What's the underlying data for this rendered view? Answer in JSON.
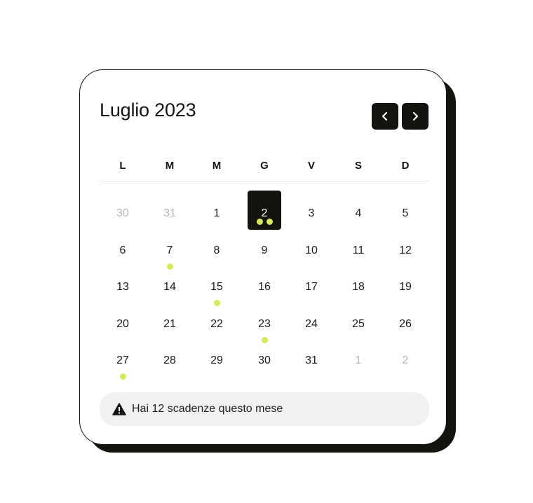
{
  "calendar": {
    "title": "Luglio 2023",
    "nav": {
      "prev_icon": "chevron-left-icon",
      "next_icon": "chevron-right-icon"
    },
    "weekdays": [
      "L",
      "M",
      "M",
      "G",
      "V",
      "S",
      "D"
    ],
    "weeks": [
      [
        {
          "day": "30",
          "muted": true,
          "dots": 0
        },
        {
          "day": "31",
          "muted": true,
          "dots": 0
        },
        {
          "day": "1",
          "muted": false,
          "dots": 0
        },
        {
          "day": "2",
          "muted": false,
          "dots": 2,
          "selected": true
        },
        {
          "day": "3",
          "muted": false,
          "dots": 0
        },
        {
          "day": "4",
          "muted": false,
          "dots": 0
        },
        {
          "day": "5",
          "muted": false,
          "dots": 0
        }
      ],
      [
        {
          "day": "6",
          "muted": false,
          "dots": 0
        },
        {
          "day": "7",
          "muted": false,
          "dots": 1
        },
        {
          "day": "8",
          "muted": false,
          "dots": 0
        },
        {
          "day": "9",
          "muted": false,
          "dots": 0
        },
        {
          "day": "10",
          "muted": false,
          "dots": 0
        },
        {
          "day": "11",
          "muted": false,
          "dots": 0
        },
        {
          "day": "12",
          "muted": false,
          "dots": 0
        }
      ],
      [
        {
          "day": "13",
          "muted": false,
          "dots": 0
        },
        {
          "day": "14",
          "muted": false,
          "dots": 0
        },
        {
          "day": "15",
          "muted": false,
          "dots": 1
        },
        {
          "day": "16",
          "muted": false,
          "dots": 0
        },
        {
          "day": "17",
          "muted": false,
          "dots": 0
        },
        {
          "day": "18",
          "muted": false,
          "dots": 0
        },
        {
          "day": "19",
          "muted": false,
          "dots": 0
        }
      ],
      [
        {
          "day": "20",
          "muted": false,
          "dots": 0
        },
        {
          "day": "21",
          "muted": false,
          "dots": 0
        },
        {
          "day": "22",
          "muted": false,
          "dots": 0
        },
        {
          "day": "23",
          "muted": false,
          "dots": 1
        },
        {
          "day": "24",
          "muted": false,
          "dots": 0
        },
        {
          "day": "25",
          "muted": false,
          "dots": 0
        },
        {
          "day": "26",
          "muted": false,
          "dots": 0
        }
      ],
      [
        {
          "day": "27",
          "muted": false,
          "dots": 1
        },
        {
          "day": "28",
          "muted": false,
          "dots": 0
        },
        {
          "day": "29",
          "muted": false,
          "dots": 0
        },
        {
          "day": "30",
          "muted": false,
          "dots": 0
        },
        {
          "day": "31",
          "muted": false,
          "dots": 0
        },
        {
          "day": "1",
          "muted": true,
          "dots": 0
        },
        {
          "day": "2",
          "muted": true,
          "dots": 0
        }
      ]
    ],
    "alert": {
      "icon": "warning-icon",
      "text": "Hai 12 scadenze questo mese"
    },
    "colors": {
      "accent_dot": "#d6ea5c",
      "dark": "#121410",
      "alert_bg": "#f1f2ef",
      "muted_text": "#b8b8b8"
    }
  }
}
